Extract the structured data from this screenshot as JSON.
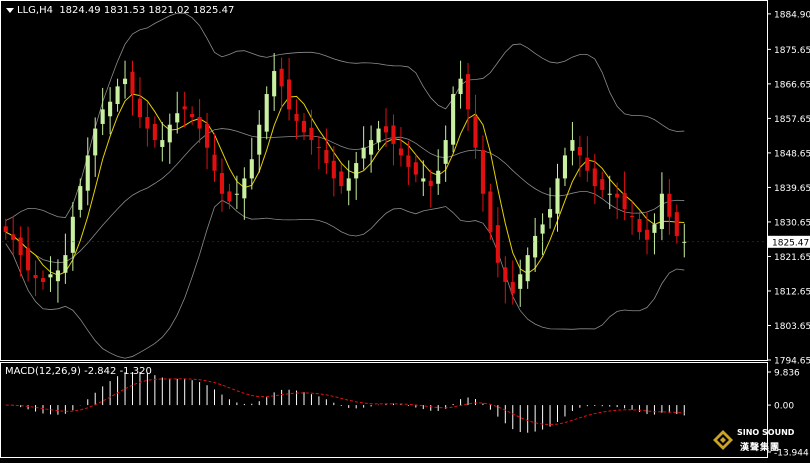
{
  "header": {
    "symbol": "LLG,H4",
    "open": "1824.49",
    "high": "1831.53",
    "low": "1821.02",
    "close": "1825.47"
  },
  "price_axis": {
    "ticks": [
      "1884.90",
      "1875.65",
      "1866.65",
      "1857.65",
      "1848.65",
      "1839.65",
      "1830.65",
      "1821.65",
      "1812.65",
      "1803.65",
      "1794.65"
    ],
    "current_price": "1825.47"
  },
  "macd": {
    "label": "MACD(12,26,9)",
    "value1": "-2.842",
    "value2": "-1.320",
    "ticks": [
      "9.836",
      "0.00",
      "-13.944"
    ]
  },
  "logo": {
    "name_en": "SINO SOUND",
    "name_cn": "漢聲集團"
  },
  "colors": {
    "background": "#000000",
    "bull_candle": "#c8f0a0",
    "bear_candle": "#e01010",
    "bollinger": "#8c8c8c",
    "ma_line": "#e6d200",
    "macd_signal": "#e01010",
    "macd_hist": "#ffffff",
    "price_tag_bg": "#ffffff",
    "price_tag_fg": "#000000"
  },
  "chart_data": {
    "type": "candlestick",
    "close": [
      1828,
      1826,
      1822,
      1818,
      1816,
      1815,
      1817,
      1818,
      1822,
      1832,
      1840,
      1848,
      1855,
      1860,
      1862,
      1866,
      1868,
      1864,
      1858,
      1855,
      1852,
      1852,
      1856,
      1859,
      1860,
      1858,
      1855,
      1850,
      1844,
      1838,
      1836,
      1838,
      1842,
      1847,
      1856,
      1864,
      1870,
      1866,
      1860,
      1857,
      1854,
      1852,
      1850,
      1846,
      1842,
      1840,
      1842,
      1846,
      1850,
      1852,
      1855,
      1854,
      1851,
      1848,
      1845,
      1843,
      1842,
      1840,
      1844,
      1852,
      1864,
      1868,
      1860,
      1850,
      1838,
      1828,
      1820,
      1815,
      1812,
      1817,
      1822,
      1827,
      1830,
      1834,
      1842,
      1848,
      1852,
      1848,
      1844,
      1840,
      1839,
      1838,
      1837,
      1834,
      1832,
      1828,
      1826,
      1830,
      1838,
      1832,
      1827,
      1825.5
    ],
    "price_range": [
      1794.65,
      1888
    ]
  }
}
